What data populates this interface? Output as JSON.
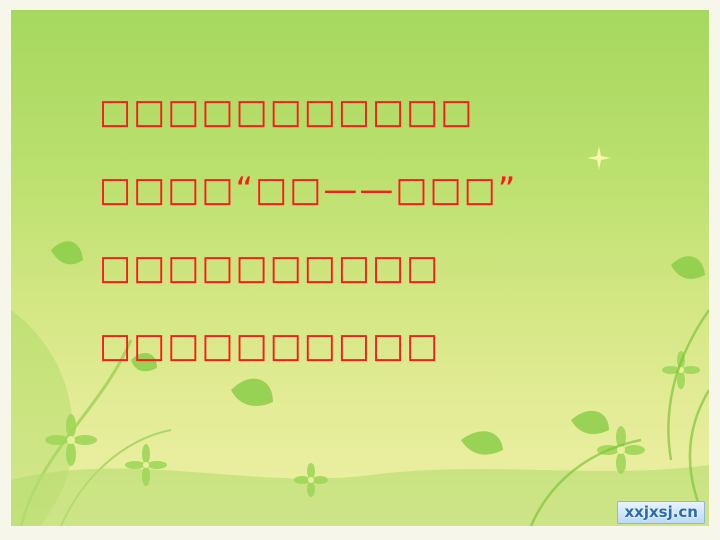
{
  "slide": {
    "lines": [
      "□□□□□□□□□□□",
      "□□□□“□□——□□□”",
      "□□□□□□□□□□",
      "□□□□□□□□□□"
    ],
    "watermark": "xxjxsj.cn"
  },
  "colors": {
    "text": "#ff1a1a",
    "background_top": "#a6d85f",
    "background_bottom": "#eef0a6",
    "foliage": "#8ccf4a"
  },
  "icons": [
    "sparkle-icon",
    "leaf-icon",
    "flower-icon"
  ]
}
